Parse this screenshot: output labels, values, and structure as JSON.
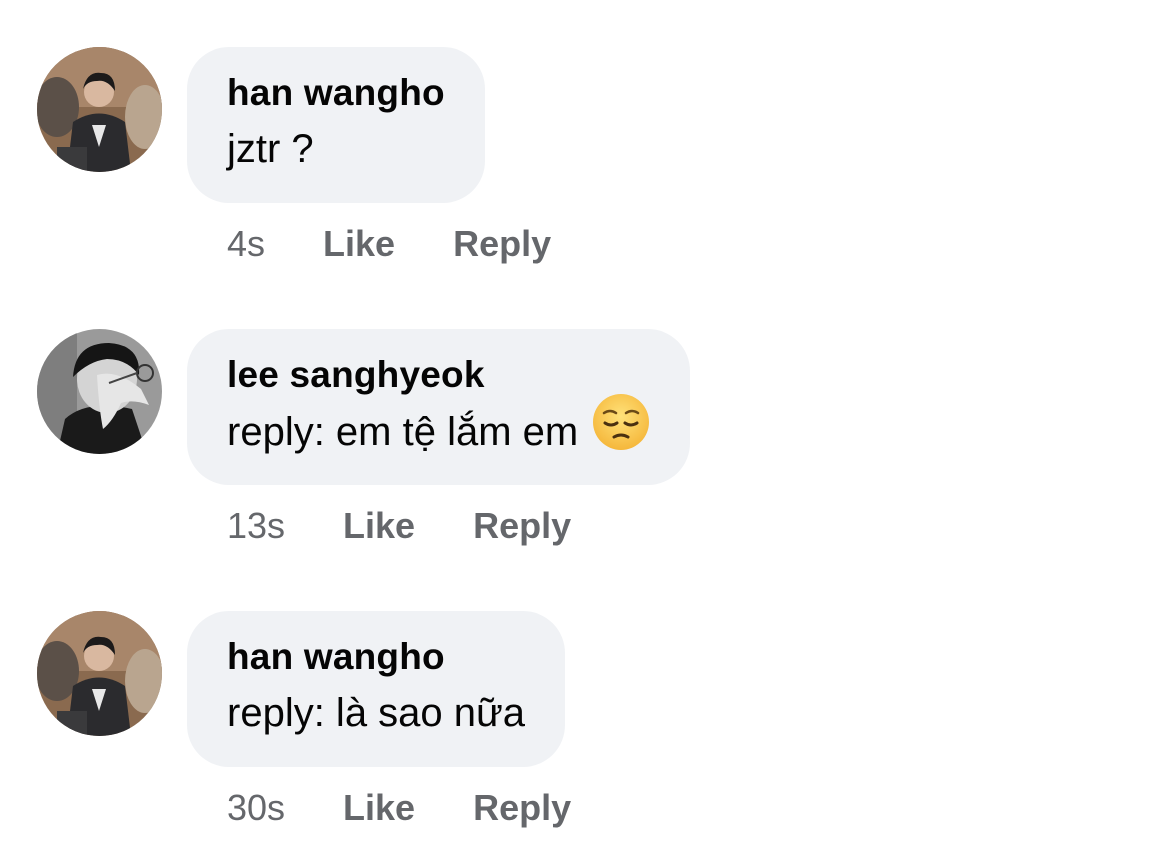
{
  "comments": [
    {
      "author": "han wangho",
      "text": "jztr ?",
      "emoji": "",
      "time": "4s",
      "like_label": "Like",
      "reply_label": "Reply",
      "avatar": "person-photo-icon"
    },
    {
      "author": "lee sanghyeok",
      "text": "reply: em tệ lắm em",
      "emoji": "pensive-face-emoji",
      "time": "13s",
      "like_label": "Like",
      "reply_label": "Reply",
      "avatar": "person-bw-photo-icon"
    },
    {
      "author": "han wangho",
      "text": "reply: là sao nữa",
      "emoji": "",
      "time": "30s",
      "like_label": "Like",
      "reply_label": "Reply",
      "avatar": "person-photo-icon"
    }
  ],
  "colors": {
    "bubble_bg": "#f0f2f5",
    "author_text": "#050505",
    "meta_text": "#65676b"
  }
}
